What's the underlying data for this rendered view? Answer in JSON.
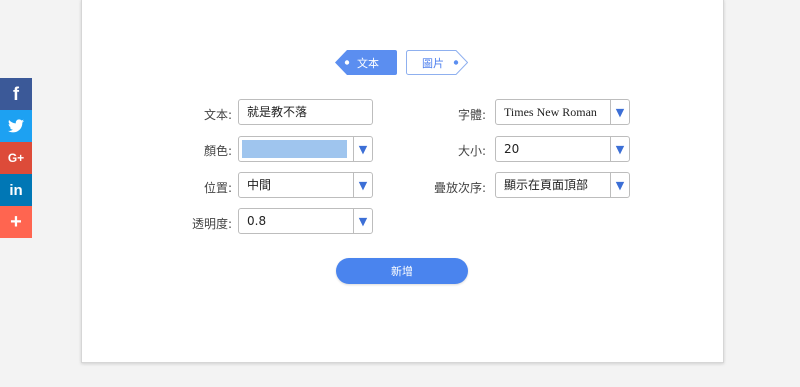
{
  "social": {
    "items": [
      {
        "icon": "facebook-icon",
        "glyph": "f",
        "color": "#3b5998"
      },
      {
        "icon": "twitter-icon",
        "glyph": "",
        "color": "#1da1f2"
      },
      {
        "icon": "google-plus-icon",
        "glyph": "G+",
        "color": "#dd4b39"
      },
      {
        "icon": "linkedin-icon",
        "glyph": "in",
        "color": "#0077b5"
      },
      {
        "icon": "more-share-icon",
        "glyph": "+",
        "color": "#ff6550"
      }
    ]
  },
  "tabs": {
    "text_label": "文本",
    "image_label": "圖片",
    "active_color": "#5b8ef0"
  },
  "form": {
    "text_label": "文本:",
    "text_value": "就是教不落",
    "color_label": "顏色:",
    "color_value": "#9fc5ee",
    "position_label": "位置:",
    "position_value": "中間",
    "opacity_label": "透明度:",
    "opacity_value": "0.8",
    "font_label": "字體:",
    "font_value": "Times New Roman",
    "size_label": "大小:",
    "size_value": "20",
    "layer_label": "疊放次序:",
    "layer_value": "顯示在頁面頂部",
    "dropdown_arrow": "▼"
  },
  "add_button_label": "新增"
}
